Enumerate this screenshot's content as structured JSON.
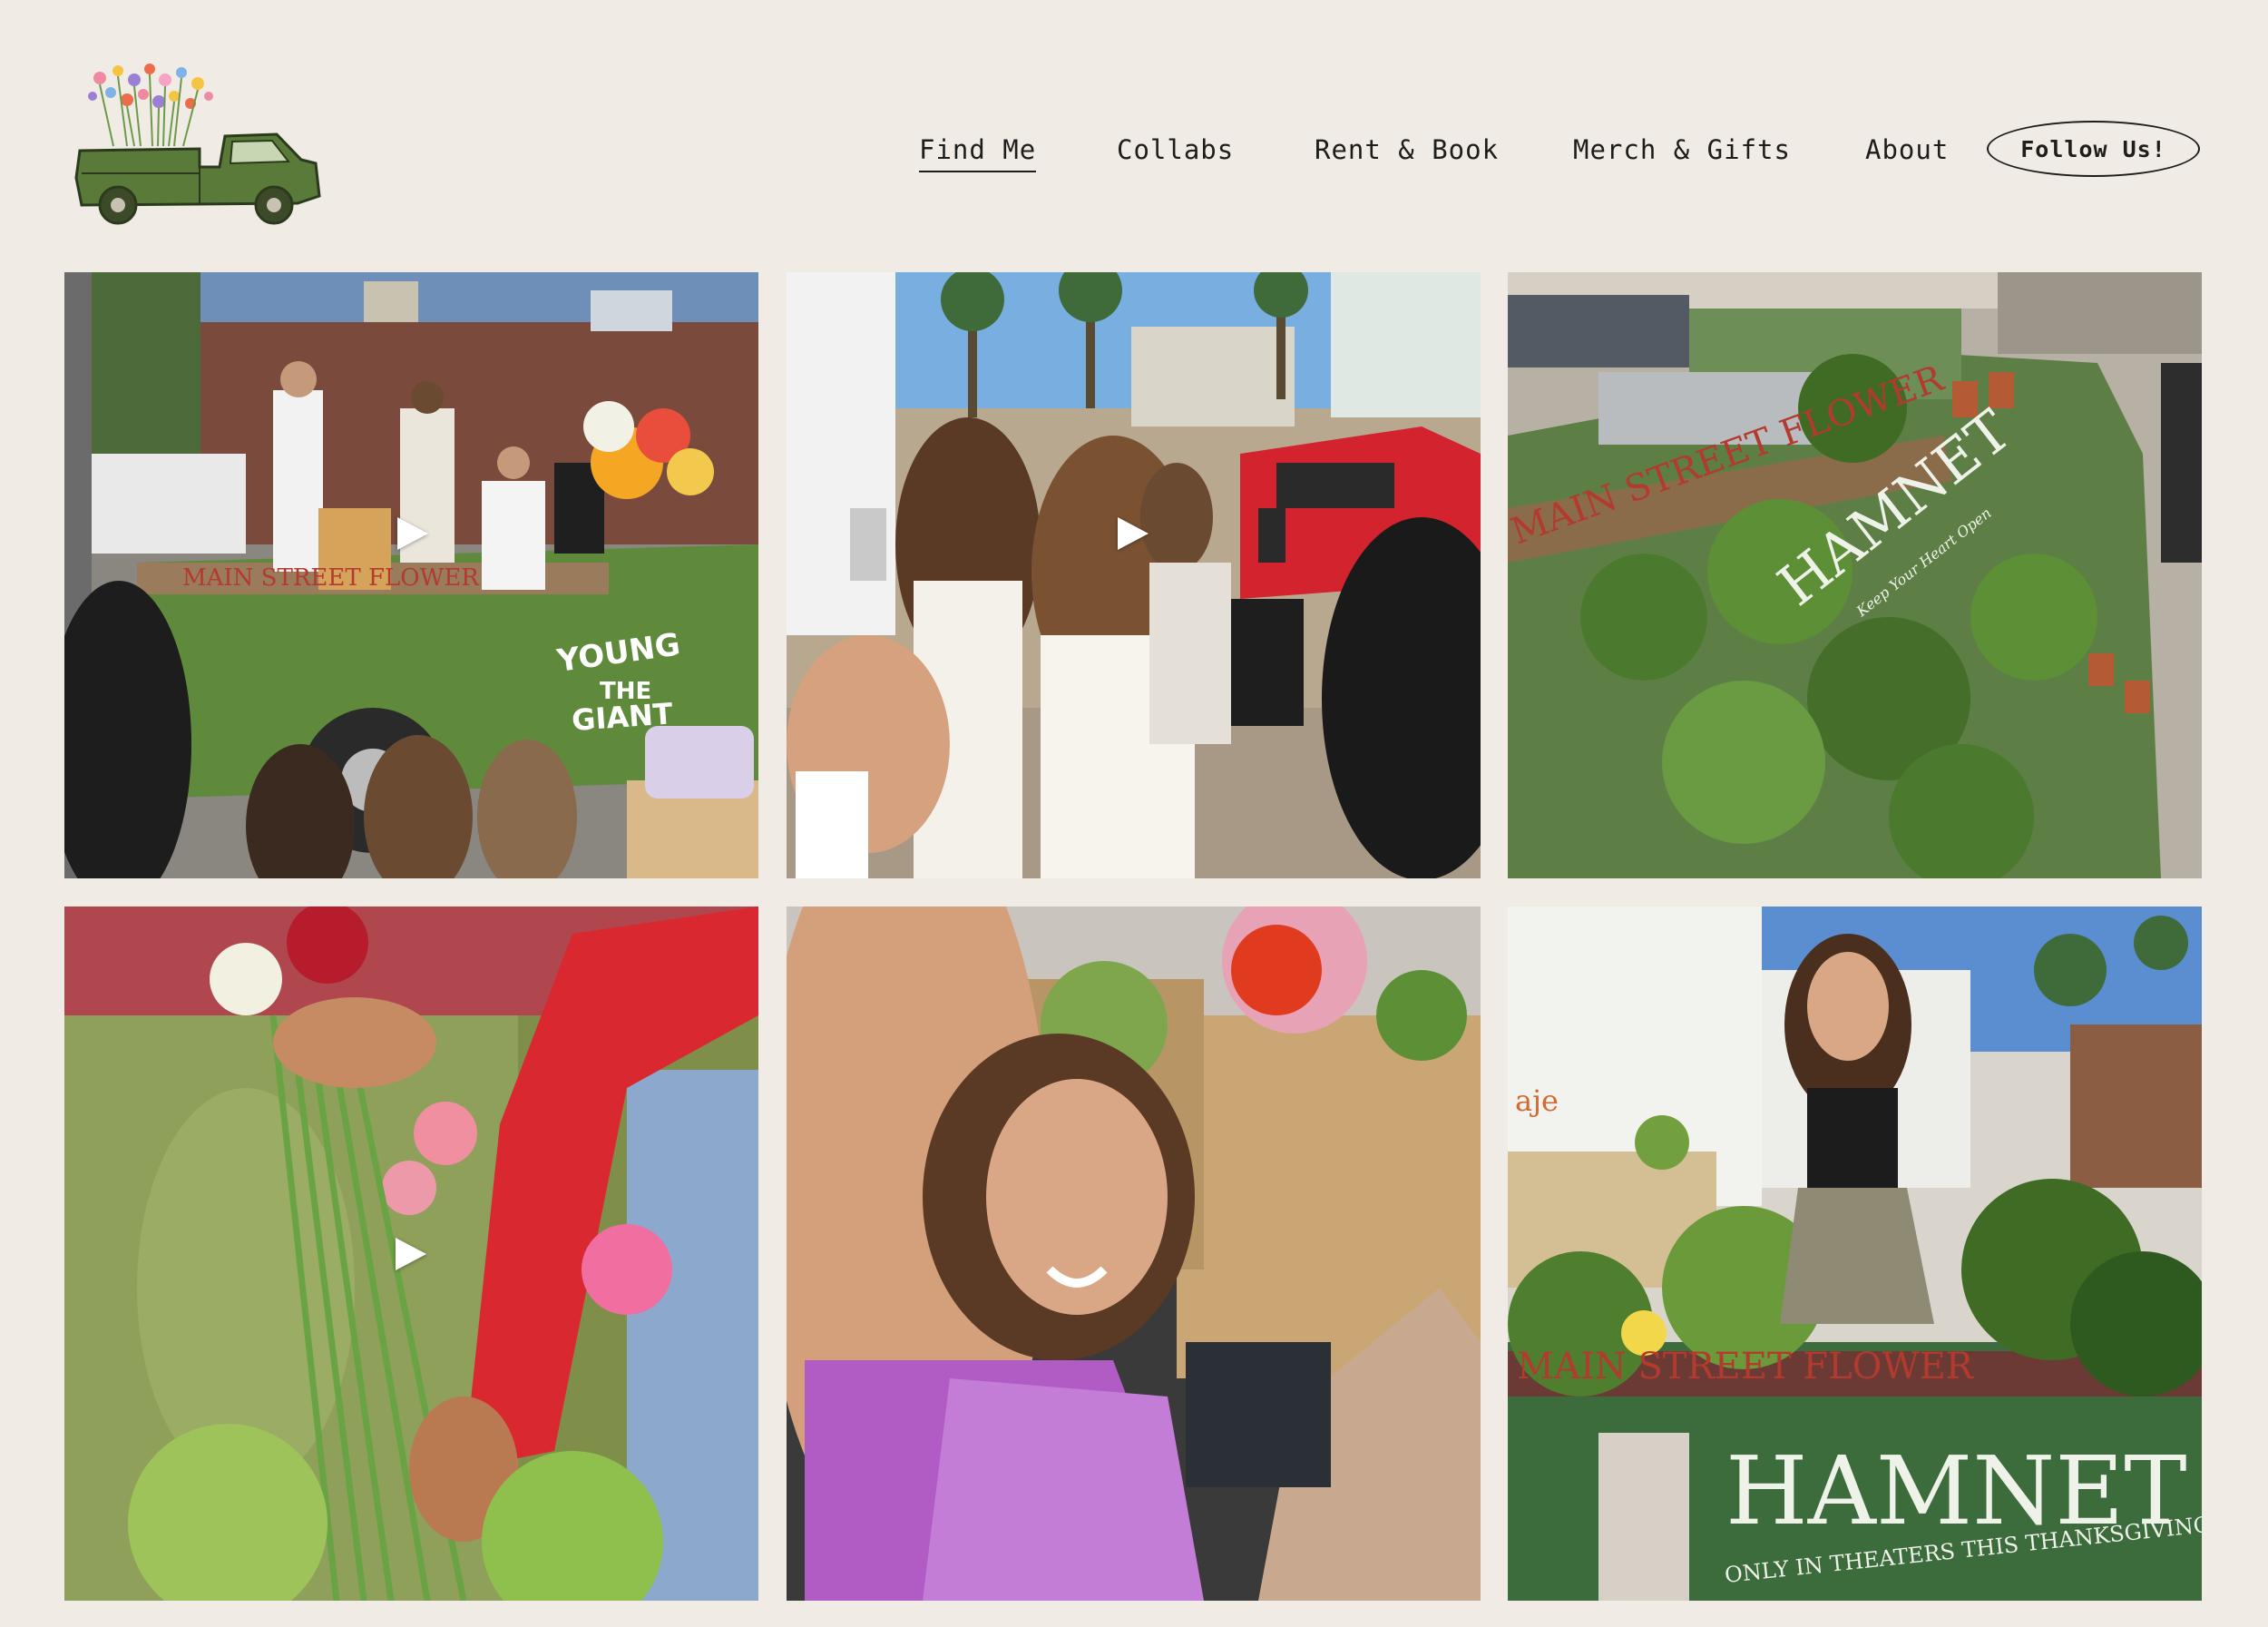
{
  "header": {
    "logo_alt": "flower truck logo",
    "nav": [
      {
        "label": "Find Me",
        "active": true
      },
      {
        "label": "Collabs",
        "active": false
      },
      {
        "label": "Rent & Book",
        "active": false
      },
      {
        "label": "Merch & Gifts",
        "active": false
      },
      {
        "label": "About",
        "active": false
      }
    ],
    "follow_label": "Follow Us!"
  },
  "gallery": {
    "tiles": [
      {
        "name": "band-performing-on-flower-truck",
        "type": "video",
        "play_icon": "play-icon",
        "painted_text": [
          "YOUNG",
          "THE",
          "GIANT",
          "MAIN STREET FLOWER"
        ]
      },
      {
        "name": "crowd-filming-on-street",
        "type": "video",
        "play_icon": "play-icon"
      },
      {
        "name": "truck-bed-full-of-plants",
        "type": "image",
        "painted_text": [
          "HAMNET",
          "Keep Your Heart Open",
          "MAIN STREET FLOWER"
        ]
      },
      {
        "name": "hands-holding-flowers",
        "type": "video",
        "play_icon": "play-icon"
      },
      {
        "name": "selfie-with-flower-bags",
        "type": "image"
      },
      {
        "name": "woman-selling-flowers-from-truck",
        "type": "image",
        "painted_text": [
          "HAMNET",
          "ONLY IN THEATERS THIS THANKSGIVING",
          "MAIN STREET FLOWER",
          "aje"
        ]
      }
    ]
  },
  "colors": {
    "background": "#f1ebe5",
    "text": "#1d1d1b",
    "truck_green": "#5a7a3a"
  }
}
